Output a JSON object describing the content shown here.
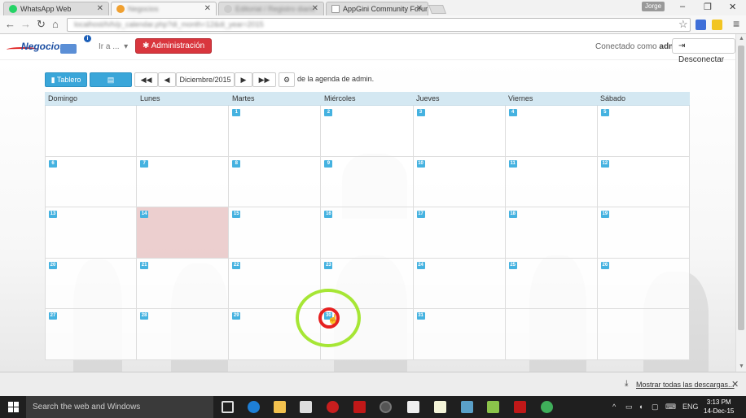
{
  "browser": {
    "tabs": [
      {
        "title": "WhatsApp Web",
        "favicon_color": "#25d366"
      },
      {
        "title": "Negocios",
        "favicon_color": "#f0a030"
      },
      {
        "title": "Editorial / Registro diario",
        "favicon_color": "#ccc"
      },
      {
        "title": "AppGini Community Forum",
        "favicon_color": "#ffffff"
      }
    ],
    "user_badge": "Jorge",
    "url": "localhost/h/h/p_calendar.php?di_month=12&di_year=2015"
  },
  "app": {
    "logo_text": "Negocios",
    "ir_menu": "Ir a ...",
    "admin_button": "Administración",
    "connected_prefix": "Conectado como",
    "connected_user": "admin",
    "logout_button": "Desconectar"
  },
  "calendar": {
    "tablero_button": "Tablero",
    "estatus_button": "Estatus",
    "month_label": "Diciembre/2015",
    "agenda_text": "de la agenda de admin.",
    "day_names": [
      "Domingo",
      "Lunes",
      "Martes",
      "Miércoles",
      "Jueves",
      "Viernes",
      "Sábado"
    ],
    "today": 14,
    "highlighted_day": 30,
    "weeks": [
      [
        "",
        "",
        "1",
        "2",
        "3",
        "4",
        "5"
      ],
      [
        "6",
        "7",
        "8",
        "9",
        "10",
        "11",
        "12"
      ],
      [
        "13",
        "14",
        "15",
        "16",
        "17",
        "18",
        "19"
      ],
      [
        "20",
        "21",
        "22",
        "23",
        "24",
        "25",
        "26"
      ],
      [
        "27",
        "28",
        "29",
        "30",
        "31",
        "",
        ""
      ]
    ]
  },
  "downloads": {
    "show_all": "Mostrar todas las descargas..."
  },
  "taskbar": {
    "search_placeholder": "Search the web and Windows",
    "lang": "ENG",
    "time": "3:13 PM",
    "date": "14-Dec-15"
  }
}
